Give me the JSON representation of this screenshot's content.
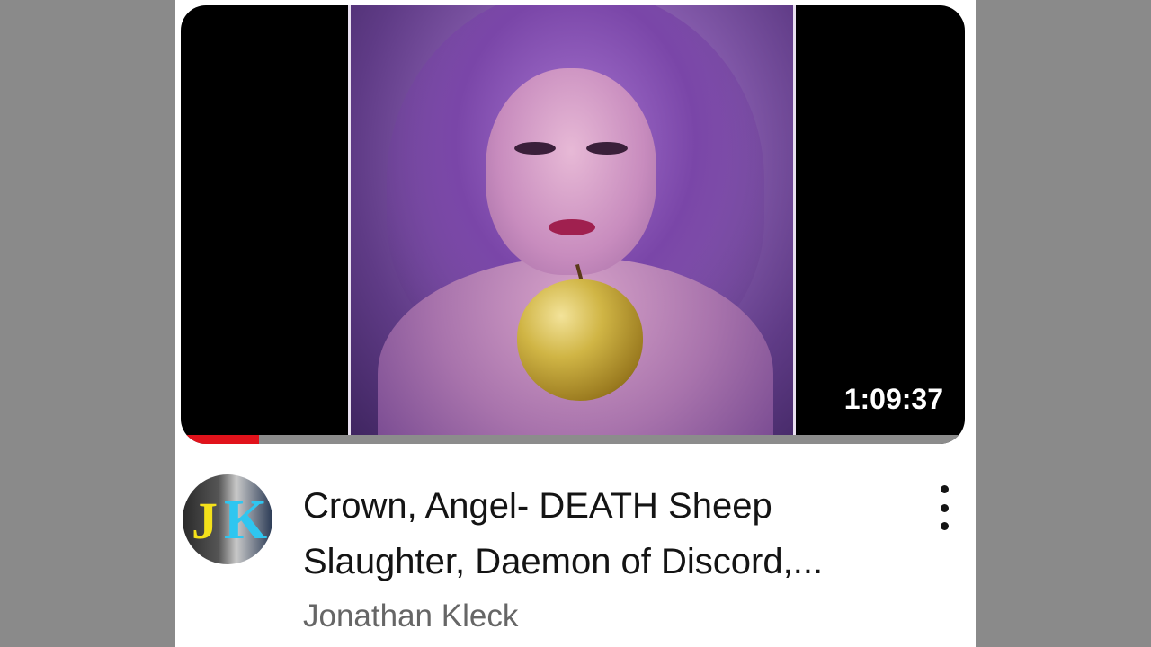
{
  "video": {
    "duration": "1:09:37",
    "watch_progress_percent": 10
  },
  "details": {
    "title": "Crown, Angel- DEATH Sheep Slaughter, Daemon of Discord,...",
    "channel": "Jonathan Kleck",
    "avatar_letter_1": "J",
    "avatar_letter_2": "K"
  },
  "icons": {
    "menu": "more-vert-icon"
  },
  "colors": {
    "progress": "#e1121b",
    "avatar_j": "#f4e11a",
    "avatar_k": "#2fc6f0"
  }
}
